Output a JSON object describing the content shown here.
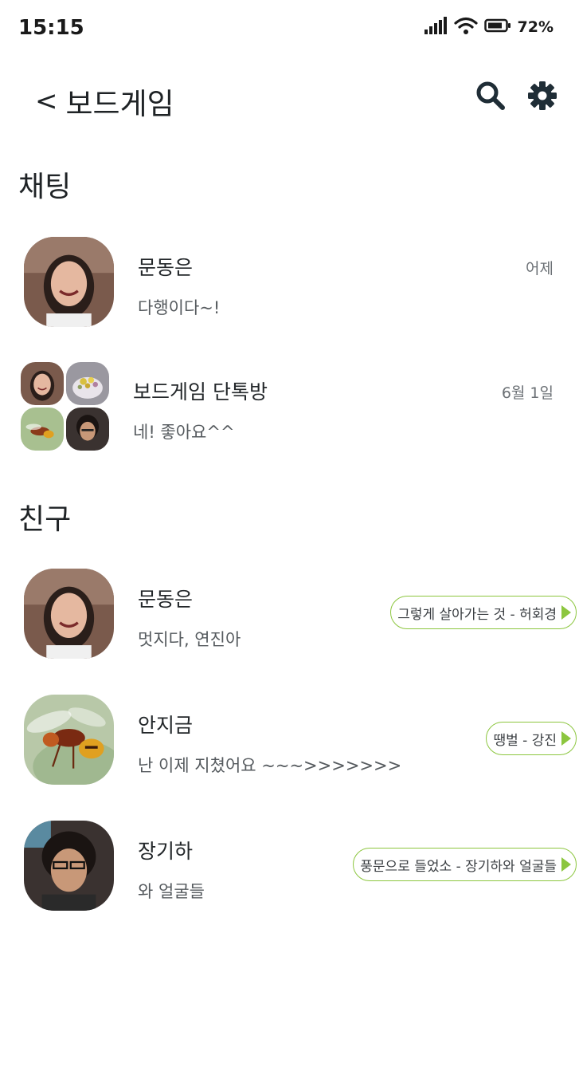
{
  "status": {
    "time": "15:15",
    "battery": "72%"
  },
  "header": {
    "back_glyph": "<",
    "title": "보드게임"
  },
  "sections": {
    "chat": "채팅",
    "friends": "친구"
  },
  "chats": [
    {
      "name": "문동은",
      "message": "다행이다~!",
      "date": "어제"
    },
    {
      "name": "보드게임 단톡방",
      "message": "네! 좋아요^^",
      "date": "6월 1일"
    }
  ],
  "friends": [
    {
      "name": "문동은",
      "message": "멋지다, 연진아",
      "music": "그렇게 살아가는 것 - 허회경"
    },
    {
      "name": "안지금",
      "message": "난 이제 지쳤어요 ~~~>>>>>>>",
      "music": "땡벌 - 강진"
    },
    {
      "name": "장기하",
      "message": "와 얼굴들",
      "music": "풍문으로 들었소 - 장기하와 얼굴들"
    }
  ],
  "colors": {
    "accent": "#8cc63f",
    "text": "#23272a",
    "subtext": "#555a5e"
  },
  "icons": [
    "signal-icon",
    "wifi-icon",
    "battery-icon",
    "search-icon",
    "gear-icon",
    "play-icon"
  ]
}
